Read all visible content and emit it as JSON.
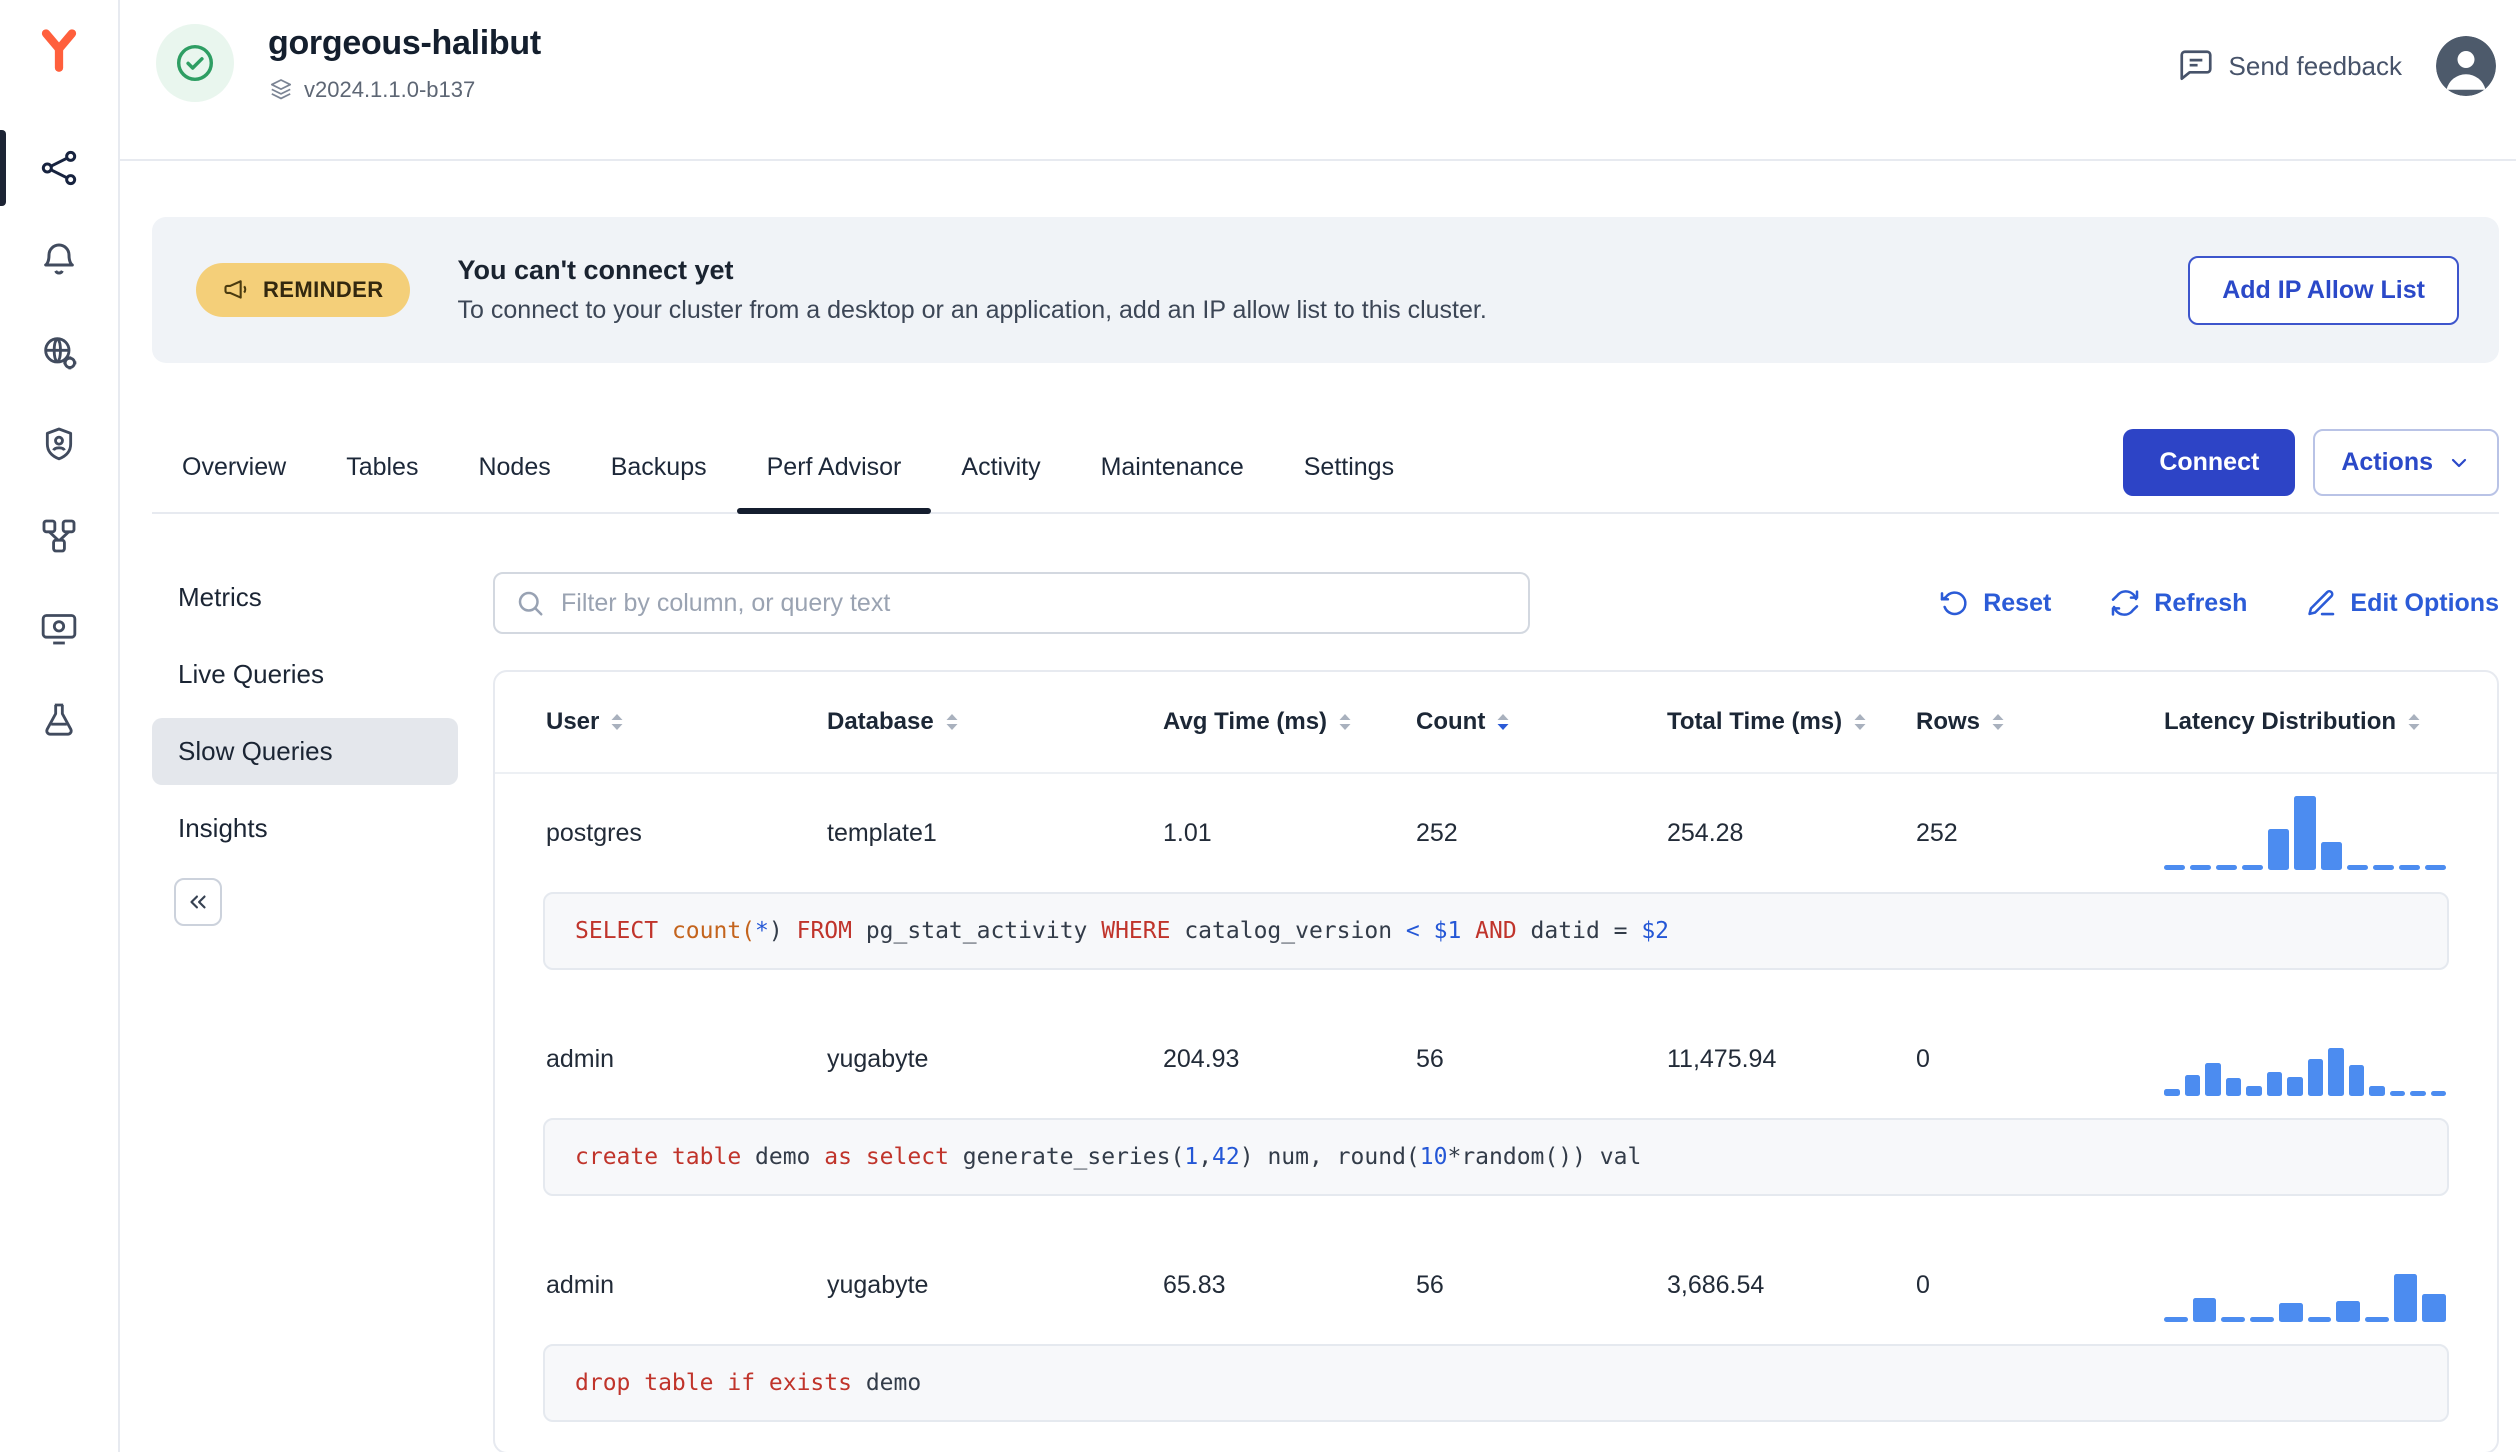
{
  "colors": {
    "accent": "#2d44c6",
    "link_blue": "#2b5bd7",
    "histogram_bar": "#4c8cf0",
    "badge_bg": "#f4cf79",
    "banner_bg": "#f0f3f7",
    "selected_pill": "#e4e7ec",
    "active_tab_underline": "#141d2e",
    "logo_orange": "#ff5f3c",
    "sql_keyword": "#c0342b",
    "sql_literal": "#2457d6",
    "health_green": "#2e9e63"
  },
  "sidebar": {
    "items": [
      {
        "name": "clusters",
        "icon": "cluster-icon",
        "active": true
      },
      {
        "name": "alerts",
        "icon": "bell-icon",
        "active": false
      },
      {
        "name": "network",
        "icon": "globe-gear-icon",
        "active": false
      },
      {
        "name": "security",
        "icon": "shield-person-icon",
        "active": false
      },
      {
        "name": "integrations",
        "icon": "topology-icon",
        "active": false
      },
      {
        "name": "billing",
        "icon": "billing-icon",
        "active": false
      },
      {
        "name": "labs",
        "icon": "flask-icon",
        "active": false
      }
    ]
  },
  "header": {
    "cluster_name": "gorgeous-halibut",
    "version": "v2024.1.1.0-b137",
    "send_feedback": "Send feedback"
  },
  "banner": {
    "badge": "REMINDER",
    "title": "You can't connect yet",
    "message": "To connect to your cluster from a desktop or an application, add an IP allow list to this cluster.",
    "action": "Add IP Allow List"
  },
  "tabs": {
    "items": [
      "Overview",
      "Tables",
      "Nodes",
      "Backups",
      "Perf Advisor",
      "Activity",
      "Maintenance",
      "Settings"
    ],
    "active": "Perf Advisor",
    "connect": "Connect",
    "actions": "Actions"
  },
  "subnav": {
    "items": [
      "Metrics",
      "Live Queries",
      "Slow Queries",
      "Insights"
    ],
    "active": "Slow Queries"
  },
  "toolbar": {
    "filter_placeholder": "Filter by column, or query text",
    "reset": "Reset",
    "refresh": "Refresh",
    "edit_options": "Edit Options"
  },
  "table": {
    "columns": [
      {
        "label": "User",
        "sort": "none"
      },
      {
        "label": "Database",
        "sort": "none"
      },
      {
        "label": "Avg Time (ms)",
        "sort": "none"
      },
      {
        "label": "Count",
        "sort": "desc"
      },
      {
        "label": "Total Time (ms)",
        "sort": "none"
      },
      {
        "label": "Rows",
        "sort": "none"
      },
      {
        "label": "Latency Distribution",
        "sort": "none"
      }
    ],
    "rows": [
      {
        "user": "postgres",
        "database": "template1",
        "avg_time": "1.01",
        "count": "252",
        "total_time": "254.28",
        "rows": "252",
        "histogram": [
          4,
          4,
          4,
          4,
          55,
          100,
          38,
          4,
          4,
          4,
          4
        ],
        "sql": [
          {
            "t": "kw",
            "v": "SELECT"
          },
          {
            "t": "fn",
            "v": " count("
          },
          {
            "t": "num",
            "v": "*"
          },
          {
            "t": "id",
            "v": ") "
          },
          {
            "t": "kw",
            "v": "FROM"
          },
          {
            "t": "id",
            "v": " pg_stat_activity "
          },
          {
            "t": "kw",
            "v": "WHERE"
          },
          {
            "t": "id",
            "v": " catalog_version "
          },
          {
            "t": "op",
            "v": "<"
          },
          {
            "t": "id",
            "v": " "
          },
          {
            "t": "num",
            "v": "$1"
          },
          {
            "t": "kw",
            "v": " AND"
          },
          {
            "t": "id",
            "v": " datid = "
          },
          {
            "t": "num",
            "v": "$2"
          }
        ]
      },
      {
        "user": "admin",
        "database": "yugabyte",
        "avg_time": "204.93",
        "count": "56",
        "total_time": "11,475.94",
        "rows": "0",
        "histogram": [
          10,
          28,
          45,
          25,
          14,
          32,
          26,
          50,
          65,
          42,
          14,
          6,
          4,
          4
        ],
        "sql": [
          {
            "t": "kw",
            "v": "create table"
          },
          {
            "t": "id",
            "v": " demo "
          },
          {
            "t": "kw",
            "v": "as"
          },
          {
            "t": "id",
            "v": " "
          },
          {
            "t": "kw",
            "v": "select"
          },
          {
            "t": "id",
            "v": " generate_series("
          },
          {
            "t": "num",
            "v": "1"
          },
          {
            "t": "id",
            "v": ","
          },
          {
            "t": "num",
            "v": "42"
          },
          {
            "t": "id",
            "v": ") num, round("
          },
          {
            "t": "num",
            "v": "10"
          },
          {
            "t": "id",
            "v": "*random()) val"
          }
        ]
      },
      {
        "user": "admin",
        "database": "yugabyte",
        "avg_time": "65.83",
        "count": "56",
        "total_time": "3,686.54",
        "rows": "0",
        "histogram": [
          4,
          32,
          4,
          4,
          26,
          4,
          28,
          4,
          65,
          38
        ],
        "sql": [
          {
            "t": "kw",
            "v": "drop table"
          },
          {
            "t": "id",
            "v": " "
          },
          {
            "t": "kw",
            "v": "if exists"
          },
          {
            "t": "id",
            "v": " demo"
          }
        ]
      }
    ]
  }
}
